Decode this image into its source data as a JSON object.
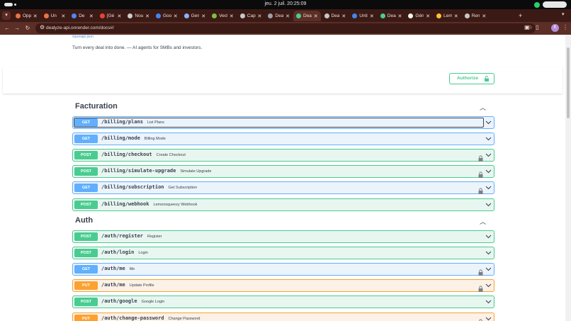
{
  "os": {
    "clock": "jeu. 2 juil.  20:25:09"
  },
  "tabs": [
    {
      "label": "Opp",
      "color": "#e8734a",
      "active": false
    },
    {
      "label": "Un",
      "color": "#e8734a",
      "active": false
    },
    {
      "label": "De",
      "color": "#4f86f7",
      "active": false
    },
    {
      "label": "[Gé",
      "color": "#ea4335",
      "active": false
    },
    {
      "label": "Nou",
      "color": "#cccccc",
      "active": false
    },
    {
      "label": "Goo",
      "color": "#4285f4",
      "active": false
    },
    {
      "label": "Gem",
      "color": "#8ab4f8",
      "active": false
    },
    {
      "label": "Vect",
      "color": "#7ac143",
      "active": false
    },
    {
      "label": "Capt",
      "color": "#c7c7c7",
      "active": false
    },
    {
      "label": "Deal",
      "color": "#9aa0a6",
      "active": false
    },
    {
      "label": "Deal",
      "color": "#49cc90",
      "active": true
    },
    {
      "label": "Deal",
      "color": "#c7c7c7",
      "active": false
    },
    {
      "label": "Untit",
      "color": "#4285f4",
      "active": false
    },
    {
      "label": "Deal",
      "color": "#49cc90",
      "active": false
    },
    {
      "label": "Géné",
      "color": "#f1f1f1",
      "active": false
    },
    {
      "label": "Lem",
      "color": "#ffc233",
      "active": false
    },
    {
      "label": "Rend",
      "color": "#c7c7c7",
      "active": false
    }
  ],
  "toolbar": {
    "url": "dealyze-api.onrender.com/docs#/",
    "profile_initial": "K"
  },
  "info": {
    "openapi_link": "/openapi.json",
    "description": "Turn every deal into done. — AI agents for SMBs and investors."
  },
  "authorize": {
    "label": "Authorize"
  },
  "sections": [
    {
      "title": "Facturation",
      "operations": [
        {
          "method": "GET",
          "path": "/billing/plans",
          "summary": "List Plans",
          "locked": false
        },
        {
          "method": "GET",
          "path": "/billing/mode",
          "summary": "Billing Mode",
          "locked": false
        },
        {
          "method": "POST",
          "path": "/billing/checkout",
          "summary": "Create Checkout",
          "locked": true
        },
        {
          "method": "POST",
          "path": "/billing/simulate-upgrade",
          "summary": "Simulate Upgrade",
          "locked": true
        },
        {
          "method": "GET",
          "path": "/billing/subscription",
          "summary": "Get Subscription",
          "locked": true
        },
        {
          "method": "POST",
          "path": "/billing/webhook",
          "summary": "Lemonsqueezy Webhook",
          "locked": false
        }
      ]
    },
    {
      "title": "Auth",
      "operations": [
        {
          "method": "POST",
          "path": "/auth/register",
          "summary": "Register",
          "locked": false
        },
        {
          "method": "POST",
          "path": "/auth/login",
          "summary": "Login",
          "locked": false
        },
        {
          "method": "GET",
          "path": "/auth/me",
          "summary": "Me",
          "locked": true
        },
        {
          "method": "PUT",
          "path": "/auth/me",
          "summary": "Update Profile",
          "locked": true
        },
        {
          "method": "POST",
          "path": "/auth/google",
          "summary": "Google Login",
          "locked": false
        },
        {
          "method": "PUT",
          "path": "/auth/change-password",
          "summary": "Change Password",
          "locked": true
        }
      ]
    }
  ]
}
